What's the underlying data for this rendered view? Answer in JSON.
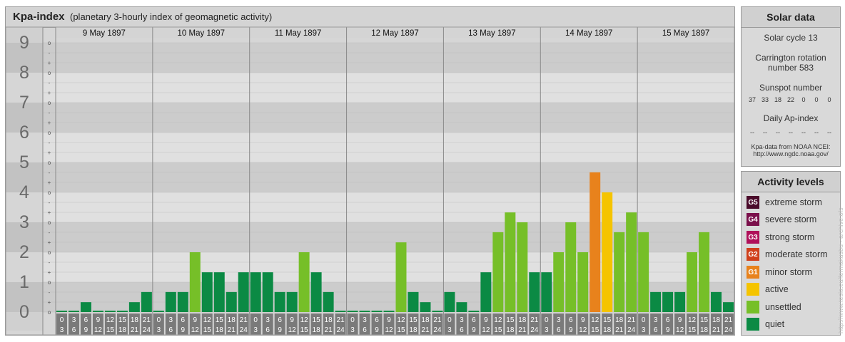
{
  "title": "Kpa-index",
  "subtitle": "(planetary 3-hourly index of geomagnetic activity)",
  "days": [
    "9 May 1897",
    "10 May 1897",
    "11 May 1897",
    "12 May 1897",
    "13 May 1897",
    "14 May 1897",
    "15 May 1897"
  ],
  "y_labels": [
    "0",
    "1",
    "2",
    "3",
    "4",
    "5",
    "6",
    "7",
    "8",
    "9"
  ],
  "sub_marks": [
    "o",
    "+",
    "-"
  ],
  "hour_bins": [
    [
      "0",
      "3"
    ],
    [
      "3",
      "6"
    ],
    [
      "6",
      "9"
    ],
    [
      "9",
      "12"
    ],
    [
      "12",
      "15"
    ],
    [
      "15",
      "18"
    ],
    [
      "18",
      "21"
    ],
    [
      "21",
      "24"
    ]
  ],
  "solar": {
    "title": "Solar data",
    "cycle": "Solar cycle 13",
    "carrington_line1": "Carrington rotation",
    "carrington_line2": "number 583",
    "sunspot_title": "Sunspot number",
    "sunspots": [
      "37",
      "33",
      "18",
      "22",
      "0",
      "0",
      "0"
    ],
    "ap_title": "Daily Ap-index",
    "ap": [
      "--",
      "--",
      "--",
      "--",
      "--",
      "--",
      "--"
    ],
    "source_line1": "Kpa-data from NOAA NCEI:",
    "source_line2": "http://www.ngdc.noaa.gov/"
  },
  "legend": {
    "title": "Activity levels",
    "items": [
      {
        "code": "G5",
        "label": "extreme storm",
        "color": "#4a0a2a"
      },
      {
        "code": "G4",
        "label": "severe storm",
        "color": "#7a0f4a"
      },
      {
        "code": "G3",
        "label": "strong storm",
        "color": "#b0105a"
      },
      {
        "code": "G2",
        "label": "moderate storm",
        "color": "#d0401c"
      },
      {
        "code": "G1",
        "label": "minor storm",
        "color": "#e8821c"
      },
      {
        "code": "",
        "label": "active",
        "color": "#f5c400"
      },
      {
        "code": "",
        "label": "unsettled",
        "color": "#76bf28"
      },
      {
        "code": "",
        "label": "quiet",
        "color": "#0b8a44"
      }
    ]
  },
  "credit": "http://www.tesla.eu/fermakusbu - archive.ofs",
  "chart_data": {
    "type": "bar",
    "title": "Kpa-index",
    "ylim": [
      0,
      9
    ],
    "series": [
      {
        "day": "9 May 1897",
        "values": [
          0,
          0,
          0.33,
          0,
          0,
          0,
          0.33,
          0.67
        ]
      },
      {
        "day": "10 May 1897",
        "values": [
          0,
          0.67,
          0.67,
          2,
          1.33,
          1.33,
          0.67,
          1.33
        ]
      },
      {
        "day": "11 May 1897",
        "values": [
          1.33,
          1.33,
          0.67,
          0.67,
          2,
          1.33,
          0.67,
          0
        ]
      },
      {
        "day": "12 May 1897",
        "values": [
          0,
          0,
          0,
          0,
          2.33,
          0.67,
          0.33,
          0
        ]
      },
      {
        "day": "13 May 1897",
        "values": [
          0.67,
          0.33,
          0,
          1.33,
          2.67,
          3.33,
          3,
          1.33
        ]
      },
      {
        "day": "14 May 1897",
        "values": [
          1.33,
          2,
          3,
          2,
          4.67,
          4,
          2.67,
          3.33
        ]
      },
      {
        "day": "15 May 1897",
        "values": [
          2.67,
          0.67,
          0.67,
          0.67,
          2,
          2.67,
          0.67,
          0.33
        ]
      }
    ]
  }
}
